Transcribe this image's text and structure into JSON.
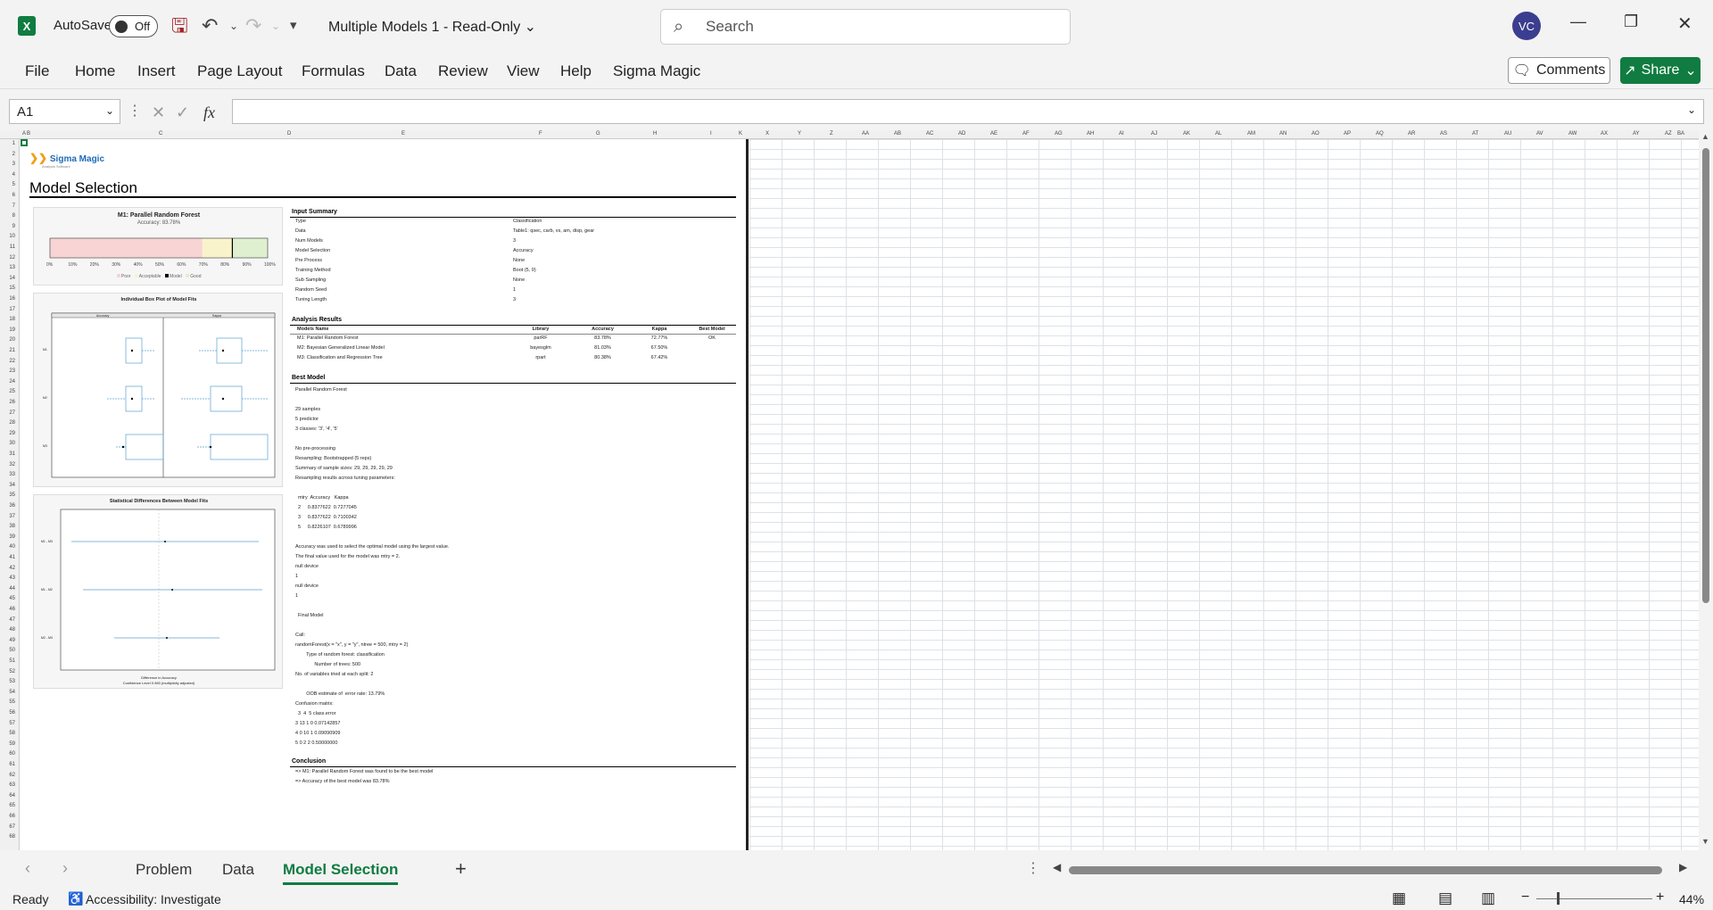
{
  "app": {
    "autosave_label": "AutoSave",
    "autosave_state": "Off",
    "doc_title": "Multiple Models 1  -  Read-Only",
    "search_placeholder": "Search",
    "avatar": "VC"
  },
  "ribbon": {
    "tabs": [
      "File",
      "Home",
      "Insert",
      "Page Layout",
      "Formulas",
      "Data",
      "Review",
      "View",
      "Help",
      "Sigma Magic"
    ],
    "comments": "Comments",
    "share": "Share"
  },
  "formula": {
    "cell": "A1",
    "fx": "fx",
    "value": ""
  },
  "columns": [
    "A",
    "B",
    "C",
    "D",
    "E",
    "F",
    "G",
    "H",
    "I",
    "K",
    "X",
    "Y",
    "Z",
    "AA",
    "AB",
    "AC",
    "AD",
    "AE",
    "AF",
    "AG",
    "AH",
    "AI",
    "AJ",
    "AK",
    "AL",
    "AM",
    "AN",
    "AO",
    "AP",
    "AQ",
    "AR",
    "AS",
    "AT",
    "AU",
    "AV",
    "AW",
    "AX",
    "AY",
    "AZ",
    "BA"
  ],
  "report": {
    "logo": "Sigma Magic",
    "logo_sub": "Analysis Software",
    "title": "Model Selection",
    "gauge": {
      "title": "M1: Parallel Random Forest",
      "subtitle": "Accuracy: 83.78%",
      "value": 0.8378,
      "ticks": [
        "0%",
        "10%",
        "20%",
        "30%",
        "40%",
        "50%",
        "60%",
        "70%",
        "80%",
        "90%",
        "100%"
      ],
      "legend": [
        "Poor",
        "Acceptable",
        "Model",
        "Good"
      ],
      "colors": {
        "poor": "#f9d4d4",
        "acceptable": "#f9f3cc",
        "good": "#dff0d0"
      }
    },
    "boxplot": {
      "title": "Individual Box Plot of Model Fits",
      "left_label": "Accuracy",
      "right_label": "Kappa",
      "models": [
        "M1",
        "M2",
        "M3"
      ]
    },
    "diffplot": {
      "title": "Statistical Differences Between Model Fits",
      "xlabel": "Difference in Accuracy",
      "footer": "Confidence Level 0.983  (multiplicity adjusted)",
      "rows": [
        "M1 - M3",
        "M1 - M2",
        "M2 - M3"
      ]
    },
    "input_summary": {
      "header": "Input Summary",
      "rows": [
        [
          "Type",
          "Classification"
        ],
        [
          "Data",
          "Table1: qsec, carb, vs, am, disp, gear"
        ],
        [
          "Num Models",
          "3"
        ],
        [
          "Model Selection",
          "Accuracy"
        ],
        [
          "Pre Process",
          "None"
        ],
        [
          "Training Method",
          "Boot (5, 0)"
        ],
        [
          "Sub Sampling",
          "None"
        ],
        [
          "Random Seed",
          "1"
        ],
        [
          "Tuning Length",
          "3"
        ]
      ]
    },
    "analysis_results": {
      "header": "Analysis Results",
      "columns": [
        "Models Name",
        "Library",
        "Accuracy",
        "Kappa",
        "Best Model"
      ],
      "rows": [
        [
          "M1: Parallel Random Forest",
          "parRF",
          "83.78%",
          "72.77%",
          "OK"
        ],
        [
          "M2: Bayesian Generalized Linear Model",
          "bayesglm",
          "81.03%",
          "67.50%",
          ""
        ],
        [
          "M3: Classification and Regression Tree",
          "rpart",
          "80.38%",
          "67.42%",
          ""
        ]
      ]
    },
    "best_model": {
      "header": "Best Model",
      "text": "Parallel Random Forest\n\n29 samples\n5 predictor\n3 classes: '3', '4', '5'\n\nNo pre-processing\nResampling: Bootstrapped (5 reps)\nSummary of sample sizes: 29, 29, 29, 29, 29\nResampling results across tuning parameters:\n\n  mtry  Accuracy   Kappa\n  2     0.8377622  0.7277045\n  3     0.8377622  0.7100342\n  5     0.8226107  0.6789996\n\nAccuracy was used to select the optimal model using the largest value.\nThe final value used for the model was mtry = 2.\nnull device\n1\nnull device\n1\n\n  Final Model\n\nCall:\nrandomForest(x = \"x\", y = \"y\", ntree = 500, mtry = 2)\n        Type of random forest: classification\n              Number of trees: 500\nNo. of variables tried at each split: 2\n\n        OOB estimate of  error rate: 13.79%\nConfusion matrix:\n  3  4  5 class.error\n3 13 1 0 0.07142857\n4 0 10 1 0.09090909\n5 0 2 2 0.50000000"
    },
    "conclusion": {
      "header": "Conclusion",
      "lines": [
        "=> M1: Parallel Random Forest was found to be the best model",
        "=> Accuracy of the best model was 83.78%"
      ]
    }
  },
  "sheets": [
    "Problem",
    "Data",
    "Model Selection"
  ],
  "active_sheet": "Model Selection",
  "status": {
    "ready": "Ready",
    "accessibility": "Accessibility: Investigate",
    "zoom": "44%"
  }
}
